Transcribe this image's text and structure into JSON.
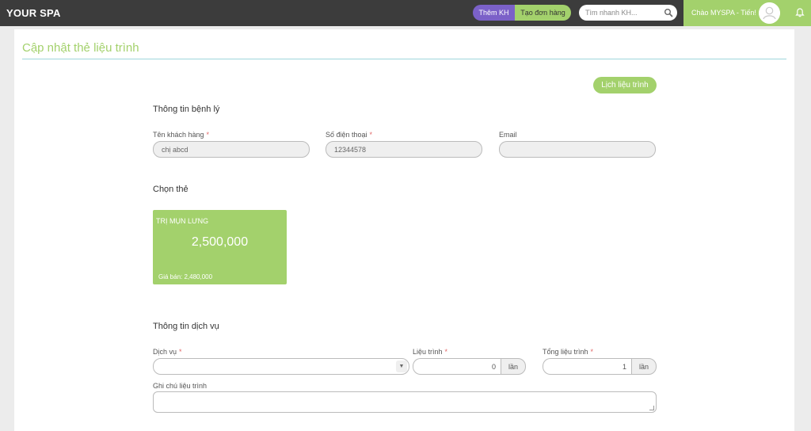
{
  "header": {
    "brand": "YOUR SPA",
    "add_customer_label": "Thêm KH",
    "create_order_label": "Tạo đơn hàng",
    "search_placeholder": "Tìm nhanh KH...",
    "greeting": "Chào MYSPA - Tiến!",
    "colors": {
      "topbar": "#3c3c3c",
      "accent_green": "#a3d16c",
      "accent_purple": "#7b61c8"
    }
  },
  "page": {
    "title": "Cập nhật thẻ liệu trình",
    "history_button": "Lịch liệu trình"
  },
  "patient_info": {
    "heading": "Thông tin bệnh lý",
    "customer_name": {
      "label": "Tên khách hàng",
      "required": "*",
      "value": "chị abcd"
    },
    "phone": {
      "label": "Số điện thoại",
      "required": "*",
      "value": "12344578"
    },
    "email": {
      "label": "Email",
      "value": ""
    }
  },
  "card_select": {
    "heading": "Chọn thẻ",
    "cards": [
      {
        "name": "TRỊ MỤN LƯNG",
        "price": "2,500,000",
        "sale_label": "Giá bán: 2,480,000"
      }
    ]
  },
  "service_info": {
    "heading": "Thông tin dịch vụ",
    "service": {
      "label": "Dịch vụ",
      "required": "*",
      "value": ""
    },
    "sessions": {
      "label": "Liệu trình",
      "required": "*",
      "value": "0",
      "unit": "lần"
    },
    "total_sessions": {
      "label": "Tổng liệu trình",
      "required": "*",
      "value": "1",
      "unit": "lần"
    },
    "note": {
      "label": "Ghi chú liệu trình",
      "value": ""
    }
  },
  "icons": {
    "search": "search-icon",
    "avatar": "user-avatar-icon",
    "bell": "bell-icon",
    "dropdown": "caret-down-icon"
  }
}
